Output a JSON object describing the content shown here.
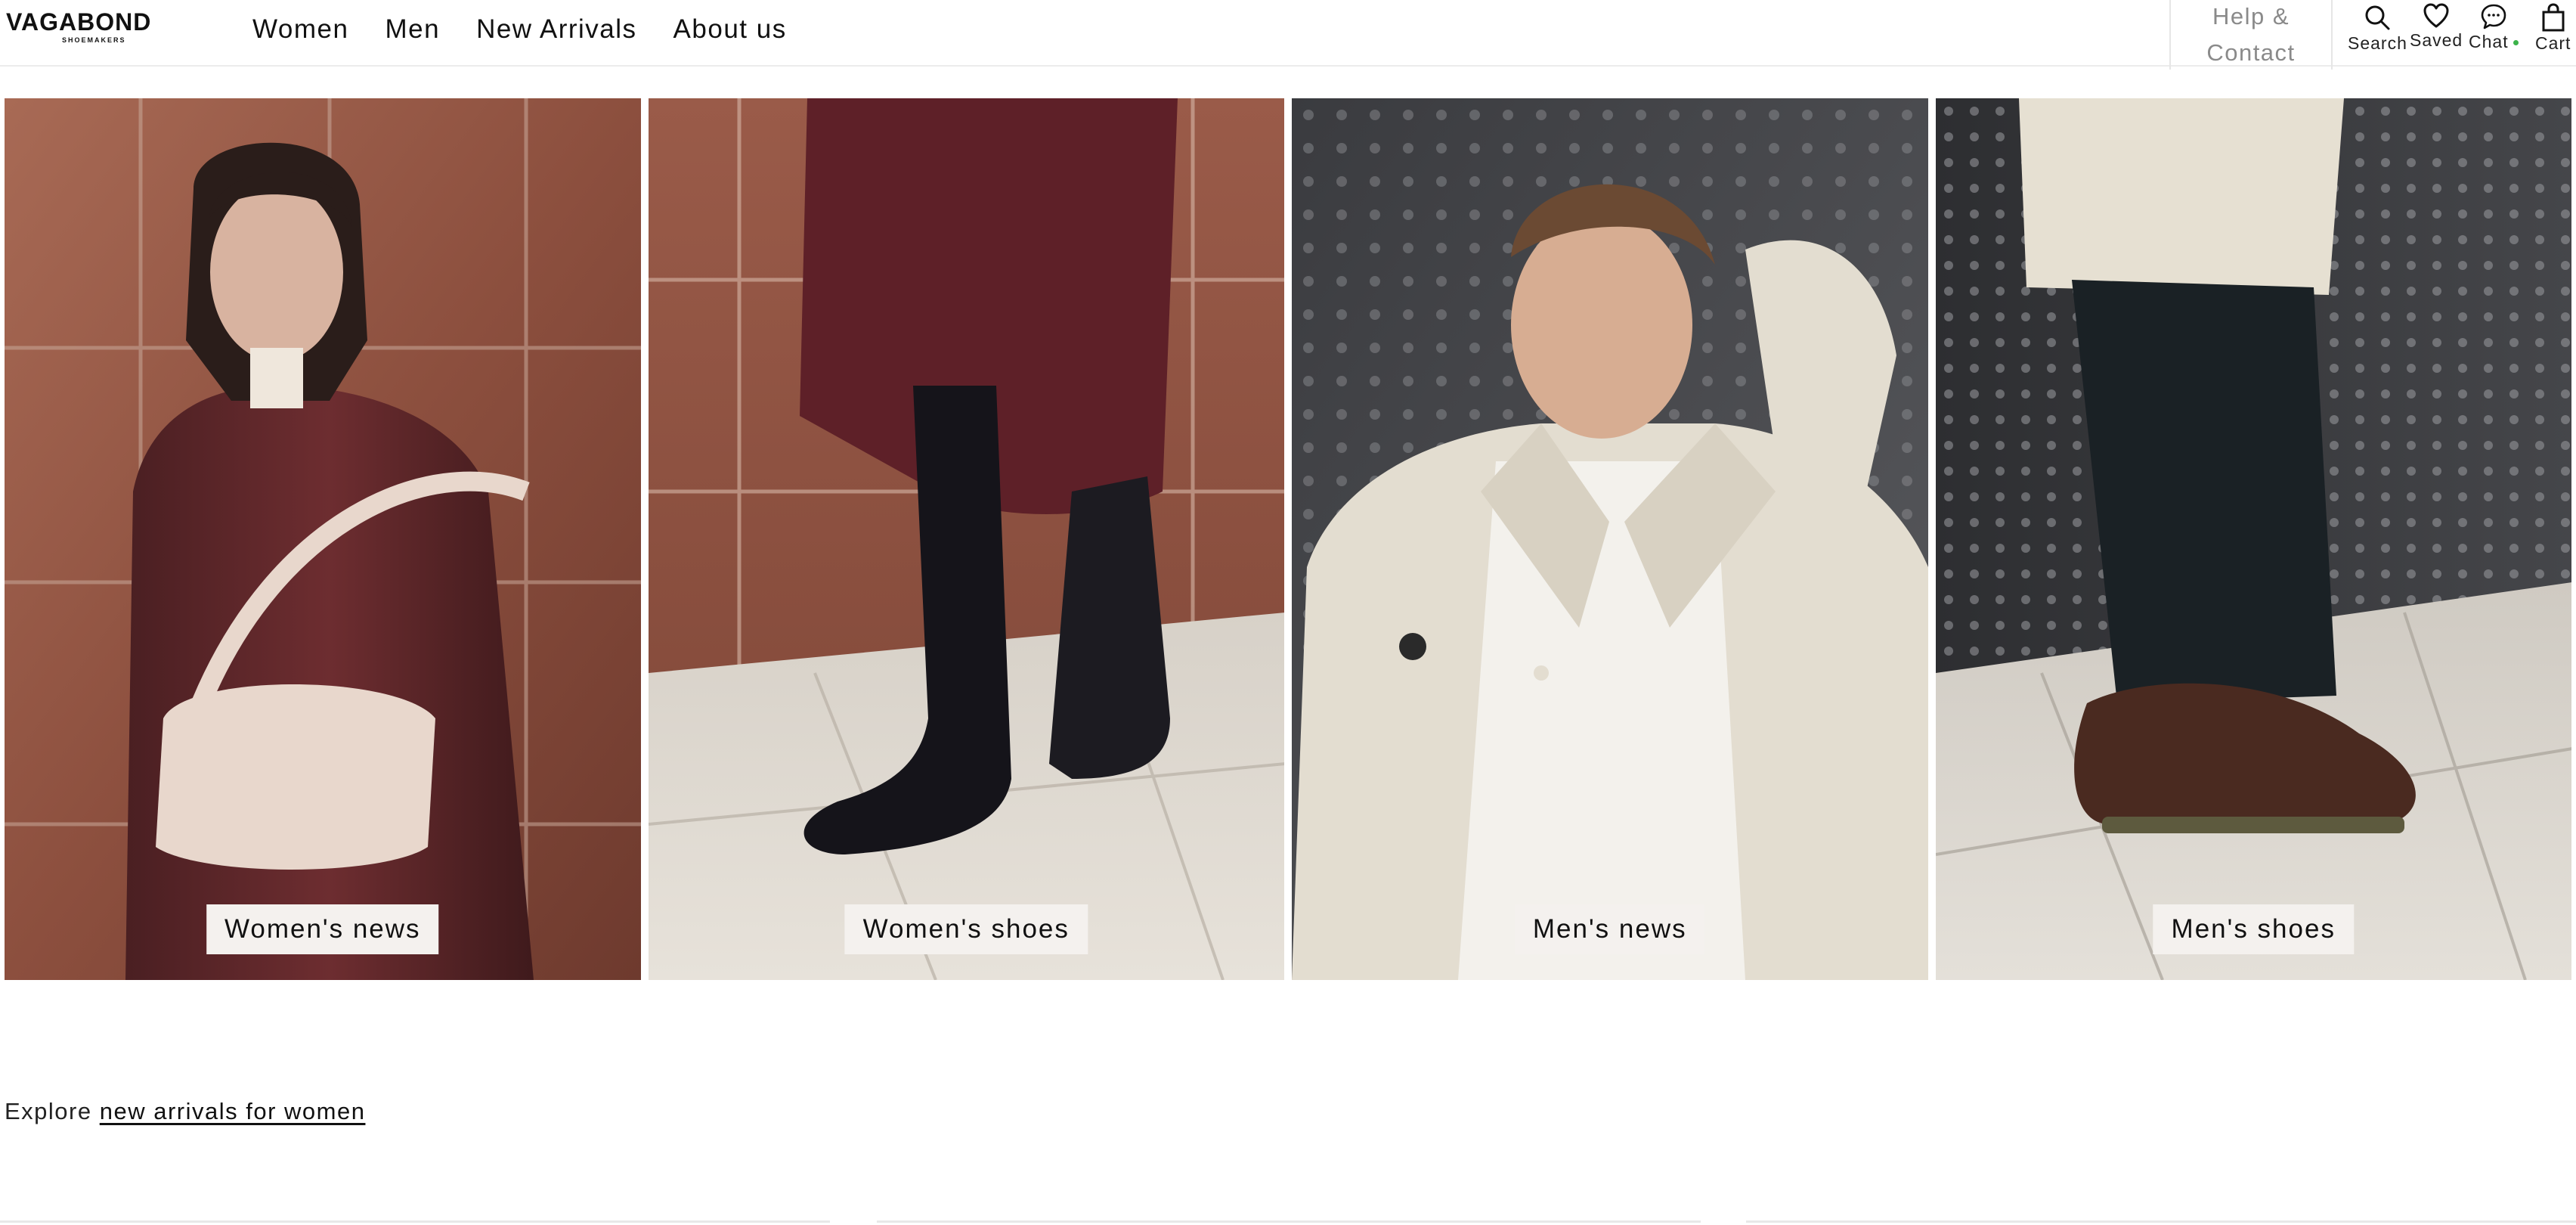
{
  "brand": {
    "name": "VAGABOND",
    "tagline": "SHOEMAKERS"
  },
  "nav": [
    {
      "label": "Women"
    },
    {
      "label": "Men"
    },
    {
      "label": "New Arrivals"
    },
    {
      "label": "About us"
    }
  ],
  "help": {
    "line1": "Help &",
    "line2": "Contact"
  },
  "utility": {
    "search": "Search",
    "saved": "Saved",
    "chat": "Chat",
    "cart": "Cart"
  },
  "tiles": [
    {
      "label": "Women's news"
    },
    {
      "label": "Women's shoes"
    },
    {
      "label": "Men's news"
    },
    {
      "label": "Men's shoes"
    }
  ],
  "explore": {
    "prefix": "Explore",
    "link": "new arrivals for women"
  },
  "colors": {
    "chat_status": "#3cb34a",
    "tile_label_bg": "#f4f1ee"
  }
}
